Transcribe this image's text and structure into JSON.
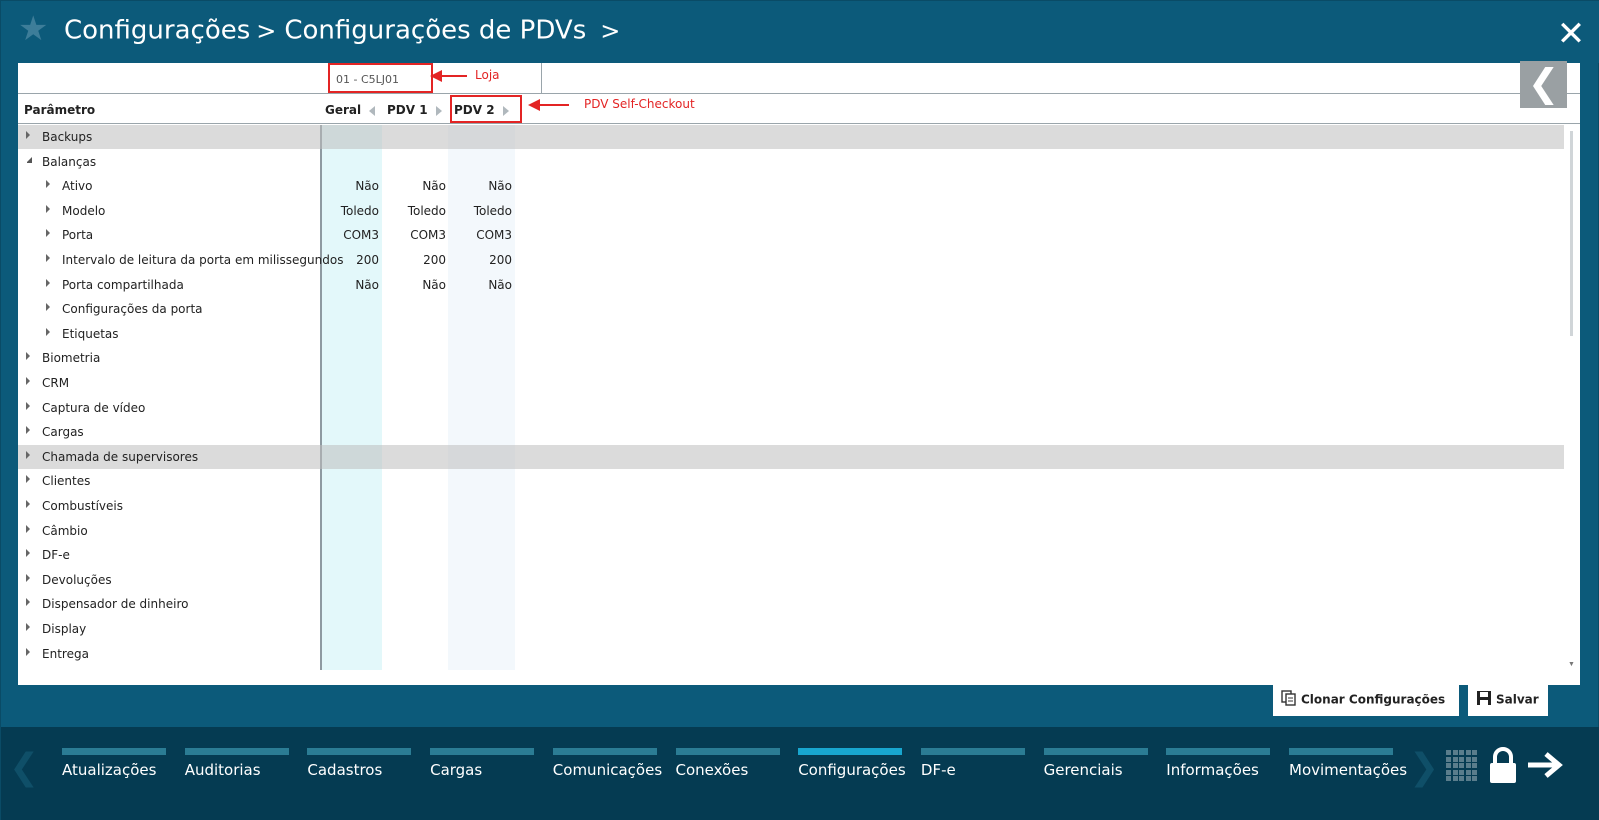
{
  "header": {
    "breadcrumb": [
      "Configurações",
      "Configurações de PDVs"
    ],
    "separator": ">"
  },
  "store": {
    "selected": "01 - C5LJ01"
  },
  "annotations": {
    "loja": "Loja",
    "pdv_self": "PDV Self-Checkout"
  },
  "columns": {
    "param": "Parâmetro",
    "geral": "Geral",
    "pdv1": "PDV 1",
    "pdv2": "PDV 2"
  },
  "rows": [
    {
      "label": "Backups",
      "level": 0,
      "expanded": false,
      "highlight": true
    },
    {
      "label": "Balanças",
      "level": 0,
      "expanded": true
    },
    {
      "label": "Ativo",
      "level": 1,
      "values": [
        "Não",
        "Não",
        "Não"
      ]
    },
    {
      "label": "Modelo",
      "level": 1,
      "values": [
        "Toledo",
        "Toledo",
        "Toledo"
      ]
    },
    {
      "label": "Porta",
      "level": 1,
      "values": [
        "COM3",
        "COM3",
        "COM3"
      ]
    },
    {
      "label": "Intervalo de leitura da porta em milissegundos",
      "level": 1,
      "values": [
        "200",
        "200",
        "200"
      ]
    },
    {
      "label": "Porta compartilhada",
      "level": 1,
      "values": [
        "Não",
        "Não",
        "Não"
      ]
    },
    {
      "label": "Configurações da porta",
      "level": 1
    },
    {
      "label": "Etiquetas",
      "level": 1
    },
    {
      "label": "Biometria",
      "level": 0
    },
    {
      "label": "CRM",
      "level": 0
    },
    {
      "label": "Captura de vídeo",
      "level": 0
    },
    {
      "label": "Cargas",
      "level": 0
    },
    {
      "label": "Chamada de supervisores",
      "level": 0,
      "highlight": true
    },
    {
      "label": "Clientes",
      "level": 0
    },
    {
      "label": "Combustíveis",
      "level": 0
    },
    {
      "label": "Câmbio",
      "level": 0
    },
    {
      "label": "DF-e",
      "level": 0
    },
    {
      "label": "Devoluções",
      "level": 0
    },
    {
      "label": "Dispensador de dinheiro",
      "level": 0
    },
    {
      "label": "Display",
      "level": 0
    },
    {
      "label": "Entrega",
      "level": 0
    }
  ],
  "actions": {
    "clone": "Clonar Configurações",
    "save": "Salvar"
  },
  "nav": {
    "items": [
      "Atualizações",
      "Auditorias",
      "Cadastros",
      "Cargas",
      "Comunicações",
      "Conexões",
      "Configurações",
      "DF-e",
      "Gerenciais",
      "Informações",
      "Movimentações"
    ],
    "active": "Configurações"
  },
  "colors": {
    "header_bg": "#0c5a7a",
    "nav_bg": "#053b52",
    "annotation": "#e32424",
    "geral_col": "#e3f8fa",
    "pdv2_col": "#f3f8fc"
  }
}
